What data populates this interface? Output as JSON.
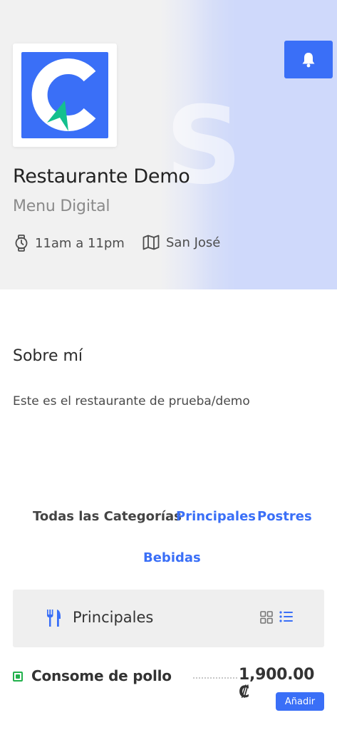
{
  "header": {
    "watermark_text": "S",
    "restaurant_name": "Restaurante Demo",
    "subtitle": "Menu Digital",
    "hours": "11am a 11pm",
    "location": "San José",
    "logo_icon": "restaurant-logo",
    "notification_icon": "bell-icon"
  },
  "about": {
    "title": "Sobre mí",
    "text": "Este es el restaurante de prueba/demo"
  },
  "categories": {
    "all": "Todas las Categorías",
    "items": [
      "Principales",
      "Postres",
      "Bebidas"
    ]
  },
  "section": {
    "title": "Principales",
    "icon": "fork-knife-icon"
  },
  "menu_items": [
    {
      "name": "Consome de pollo",
      "price": "1,900.00 ₡",
      "add_label": "Añadir"
    }
  ],
  "colors": {
    "accent": "#3a6ff7",
    "veg": "#22b14c",
    "logo_teal": "#14c08e"
  }
}
